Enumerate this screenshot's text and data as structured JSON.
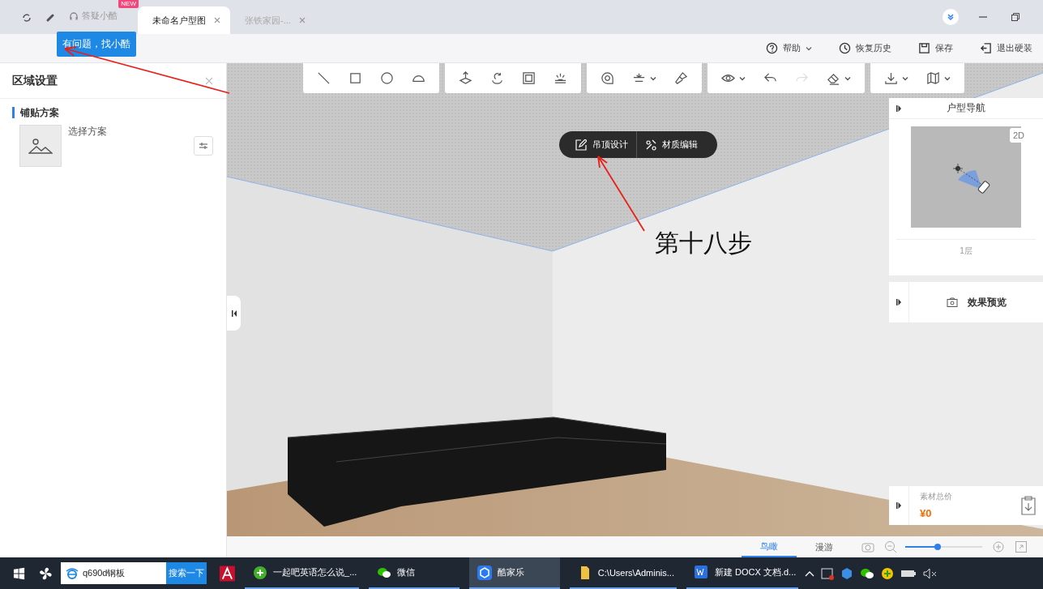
{
  "title_bar": {
    "assistant": {
      "label": "答疑小酷",
      "badge": "NEW"
    },
    "tabs": [
      {
        "label": "未命名户型图",
        "selected": true
      },
      {
        "label": "张铁家园-...",
        "selected": false
      }
    ]
  },
  "tooltip": "有问题，找小酷",
  "top_toolbar": [
    {
      "kind": "help",
      "label": "帮助",
      "dropdown": true
    },
    {
      "kind": "history",
      "label": "恢复历史",
      "dropdown": false
    },
    {
      "kind": "save",
      "label": "保存",
      "dropdown": false
    },
    {
      "kind": "exit",
      "label": "退出硬装",
      "dropdown": false
    }
  ],
  "left_panel": {
    "title": "区域设置",
    "section": "铺贴方案",
    "scheme_label": "选择方案"
  },
  "canvas_toolbar": [
    [
      {
        "kind": "line",
        "dropdown": false,
        "disabled": false
      },
      {
        "kind": "rect",
        "dropdown": false,
        "disabled": false
      },
      {
        "kind": "circle",
        "dropdown": false,
        "disabled": false
      },
      {
        "kind": "arc",
        "dropdown": false,
        "disabled": false
      }
    ],
    [
      {
        "kind": "lift",
        "dropdown": false,
        "disabled": false
      },
      {
        "kind": "rotate",
        "dropdown": false,
        "disabled": false
      },
      {
        "kind": "frame",
        "dropdown": false,
        "disabled": false
      },
      {
        "kind": "light",
        "dropdown": false,
        "disabled": false
      }
    ],
    [
      {
        "kind": "measure",
        "dropdown": false,
        "disabled": false
      },
      {
        "kind": "align",
        "dropdown": true,
        "disabled": false
      },
      {
        "kind": "brush",
        "dropdown": false,
        "disabled": false
      }
    ],
    [
      {
        "kind": "eye",
        "dropdown": true,
        "disabled": false
      },
      {
        "kind": "undo",
        "dropdown": false,
        "disabled": false
      },
      {
        "kind": "redo",
        "dropdown": false,
        "disabled": true
      },
      {
        "kind": "eraser",
        "dropdown": true,
        "disabled": false
      }
    ],
    [
      {
        "kind": "download",
        "dropdown": true,
        "disabled": false
      },
      {
        "kind": "map",
        "dropdown": true,
        "disabled": false
      }
    ]
  ],
  "context_menu": [
    {
      "kind": "ceiling",
      "label": "吊顶设计"
    },
    {
      "kind": "material",
      "label": "材质编辑"
    }
  ],
  "annotation": "第十八步",
  "nav_panel": {
    "title": "户型导航",
    "view_badge": "2D",
    "floor": "1层"
  },
  "preview_panel": {
    "title": "效果预览"
  },
  "price_panel": {
    "label": "素材总价",
    "value": "¥0"
  },
  "view_tabs": [
    {
      "label": "鸟瞰",
      "selected": true
    },
    {
      "label": "漫游",
      "selected": false
    }
  ],
  "zoom_slider": {
    "level": 0.42
  },
  "taskbar": {
    "search": {
      "value": "q690d钢板",
      "button": "搜索一下"
    },
    "apps": [
      {
        "kind": "browser",
        "label": "一起吧英语怎么说_...",
        "selected": false
      },
      {
        "kind": "chat",
        "label": "微信",
        "selected": false
      },
      {
        "kind": "kujiale",
        "label": "酷家乐",
        "selected": true
      },
      {
        "kind": "folder",
        "label": "C:\\Users\\Adminis...",
        "selected": false
      },
      {
        "kind": "doc",
        "label": "新建 DOCX 文档.d...",
        "selected": false
      }
    ]
  }
}
